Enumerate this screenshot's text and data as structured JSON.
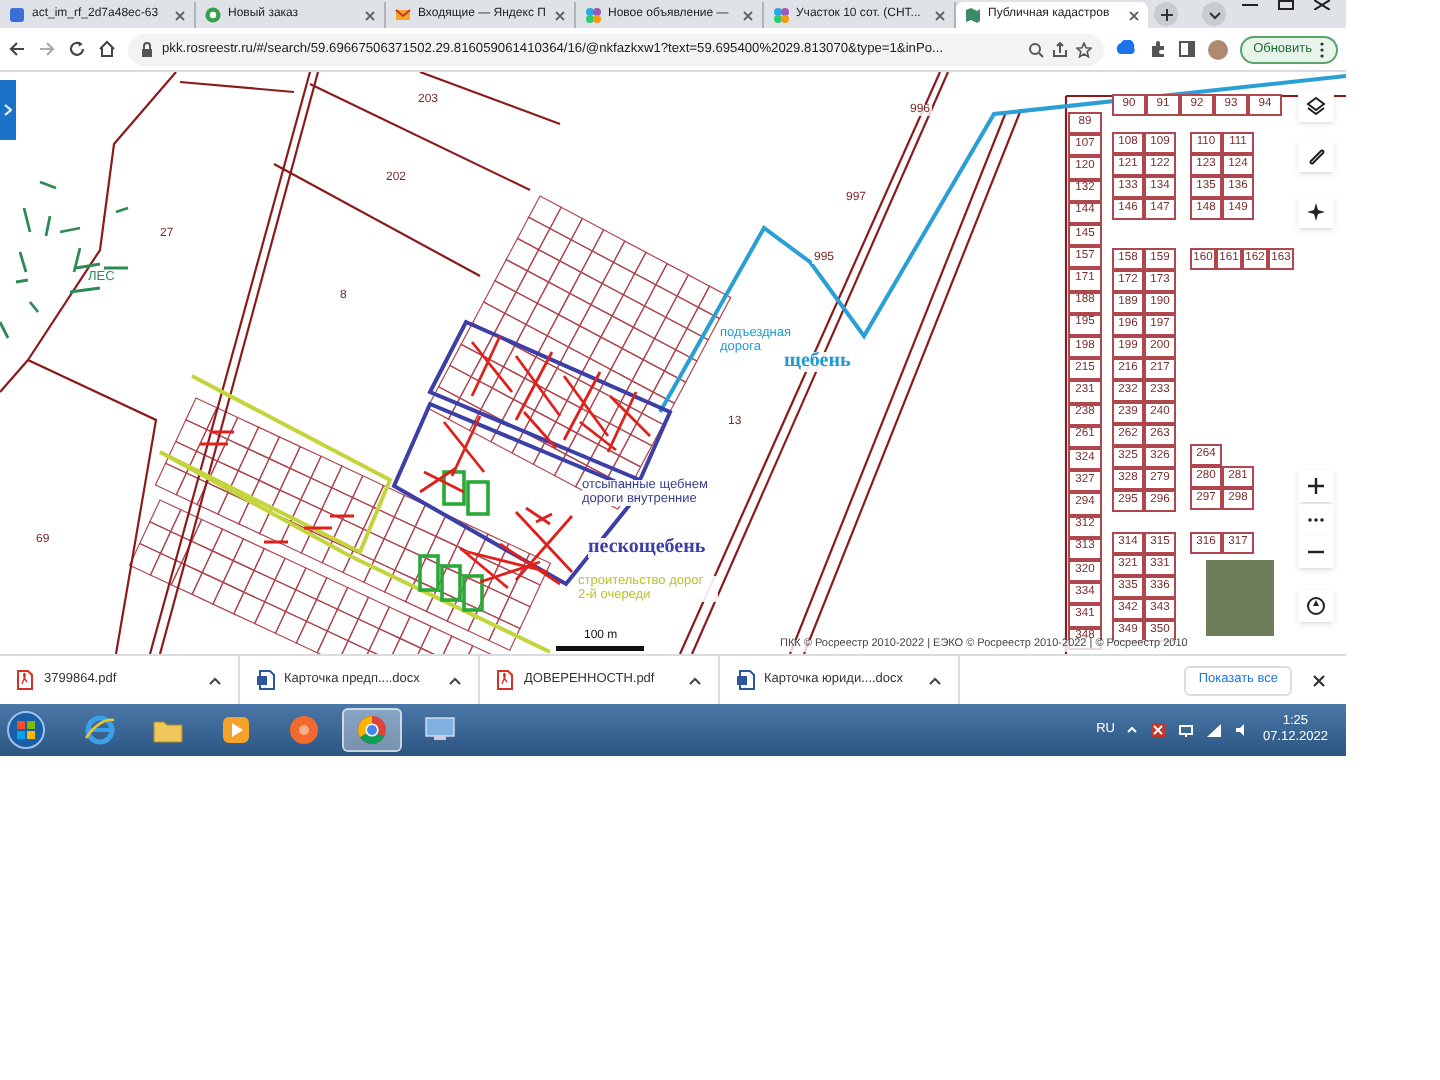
{
  "tabs": [
    {
      "title": "act_im_rf_2d7a48ec-63",
      "kind": "doc",
      "selected": false
    },
    {
      "title": "Новый заказ",
      "kind": "order",
      "selected": false
    },
    {
      "title": "Входящие — Яндекс П",
      "kind": "mail",
      "selected": false
    },
    {
      "title": "Новое объявление —",
      "kind": "ad",
      "selected": false
    },
    {
      "title": "Участок 10 сот. (СНТ...",
      "kind": "ad",
      "selected": false
    },
    {
      "title": "Публичная кадастров",
      "kind": "map",
      "selected": true
    }
  ],
  "address_bar": {
    "url": "pkk.rosreestr.ru/#/search/59.69667506371502.29.816059061410364/16/@nkfazkxw1?text=59.695400%2029.813070&type=1&inPo..."
  },
  "update_button": "Обновить",
  "map": {
    "labels": [
      {
        "text": "203",
        "kind": "parcel"
      },
      {
        "text": "202",
        "kind": "parcel"
      },
      {
        "text": "27",
        "kind": "parcel"
      },
      {
        "text": "ЛЕС",
        "kind": "forest"
      },
      {
        "text": "8",
        "kind": "parcel"
      },
      {
        "text": "69",
        "kind": "parcel"
      },
      {
        "text": "13",
        "kind": "parcel"
      },
      {
        "text": "996",
        "kind": "parcel"
      },
      {
        "text": "997",
        "kind": "parcel"
      },
      {
        "text": "995",
        "kind": "parcel"
      }
    ],
    "annotations": [
      {
        "text": "подъездная дорога",
        "kind": "access"
      },
      {
        "text": "щебень",
        "kind": "access-bold"
      },
      {
        "text": "отсыпанные щебнем дороги внутренние",
        "kind": "inner"
      },
      {
        "text": "пескощебень",
        "kind": "inner-bold"
      },
      {
        "text": "строительство дорог 2-й очереди",
        "kind": "second"
      }
    ],
    "parcel_blocks": [
      {
        "rows": [
          [
            "90",
            "91",
            "92",
            "93",
            "94"
          ]
        ]
      },
      {
        "rows": [
          [
            "89"
          ],
          [
            "107"
          ],
          [
            "120"
          ],
          [
            "132"
          ],
          [
            "144"
          ],
          [
            "145"
          ],
          [
            "157"
          ],
          [
            "171"
          ],
          [
            "188"
          ],
          [
            "195"
          ],
          [
            "198"
          ],
          [
            "215"
          ],
          [
            "231"
          ],
          [
            "238"
          ],
          [
            "261"
          ],
          [
            "324"
          ],
          [
            "327"
          ],
          [
            "294"
          ],
          [
            "312"
          ],
          [
            "313"
          ],
          [
            "320"
          ],
          [
            "334"
          ],
          [
            "341"
          ],
          [
            "348"
          ]
        ]
      },
      {
        "rows": [
          [
            "108",
            "109"
          ],
          [
            "121",
            "122"
          ],
          [
            "133",
            "134"
          ],
          [
            "146",
            "147"
          ]
        ]
      },
      {
        "rows": [
          [
            "110",
            "111"
          ],
          [
            "123",
            "124"
          ],
          [
            "135",
            "136"
          ],
          [
            "148",
            "149"
          ]
        ]
      },
      {
        "rows": [
          [
            "158",
            "159"
          ],
          [
            "172",
            "173"
          ],
          [
            "189",
            "190"
          ],
          [
            "196",
            "197"
          ],
          [
            "199",
            "200"
          ],
          [
            "216",
            "217"
          ],
          [
            "232",
            "233"
          ],
          [
            "239",
            "240"
          ],
          [
            "262",
            "263"
          ],
          [
            "325",
            "326"
          ],
          [
            "328",
            "279"
          ],
          [
            "295",
            "296"
          ]
        ]
      },
      {
        "rows": [
          [
            "160",
            "161",
            "162",
            "163"
          ]
        ]
      },
      {
        "rows": [
          [
            "264"
          ],
          [
            "280",
            "281"
          ],
          [
            "297",
            "298"
          ]
        ]
      },
      {
        "rows": [
          [
            "314",
            "315"
          ],
          [
            "321",
            "331"
          ],
          [
            "335",
            "336"
          ],
          [
            "342",
            "343"
          ],
          [
            "349",
            "350"
          ]
        ]
      },
      {
        "rows": [
          [
            "316",
            "317"
          ]
        ]
      }
    ],
    "scale": "100 m",
    "attribution": "ПКК © Росреестр 2010-2022 | ЕЭКО © Росреестр 2010-2022 | © Росреестр 2010"
  },
  "downloads": [
    {
      "name": "3799864.pdf",
      "kind": "pdf"
    },
    {
      "name": "Карточка предп....docx",
      "kind": "docx"
    },
    {
      "name": "ДОВЕРЕННОСТН.pdf",
      "kind": "pdf"
    },
    {
      "name": "Карточка юриди....docx",
      "kind": "docx"
    }
  ],
  "show_all_button": "Показать все",
  "taskbar": {
    "apps": [
      {
        "kind": "ie",
        "selected": false
      },
      {
        "kind": "folder",
        "selected": false
      },
      {
        "kind": "media",
        "selected": false
      },
      {
        "kind": "orange",
        "selected": false
      },
      {
        "kind": "chrome",
        "selected": true
      },
      {
        "kind": "remote",
        "selected": false
      }
    ],
    "language": "RU",
    "time": "1:25",
    "date": "07.12.2022"
  }
}
